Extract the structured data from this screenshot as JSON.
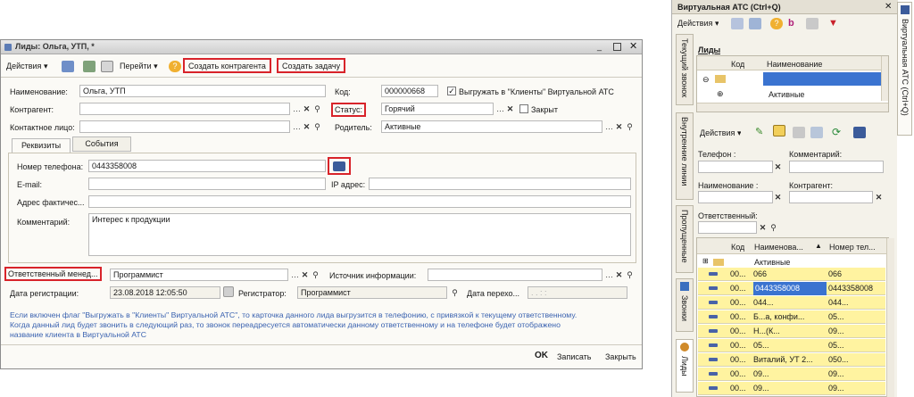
{
  "lead_window": {
    "title": "Лиды: Ольга, УТП, *",
    "toolbar": {
      "actions": "Действия",
      "goto": "Перейти",
      "create_contractor": "Создать контрагента",
      "create_task": "Создать задачу"
    },
    "fields": {
      "name_label": "Наименование:",
      "name_value": "Ольга, УТП",
      "code_label": "Код:",
      "code_value": "000000668",
      "export_checkbox_label": "Выгружать в \"Клиенты\" Виртуальной АТС",
      "export_checked": true,
      "contractor_label": "Контрагент:",
      "contractor_value": "",
      "status_label": "Статус:",
      "status_value": "Горячий",
      "closed_label": "Закрыт",
      "contact_label": "Контактное лицо:",
      "contact_value": "",
      "parent_label": "Родитель:",
      "parent_value": "Активные"
    },
    "tabs": [
      "Реквизиты",
      "События"
    ],
    "details": {
      "phone_label": "Номер телефона:",
      "phone_value": "0443358008",
      "email_label": "E-mail:",
      "email_value": "",
      "ip_label": "IP адрес:",
      "ip_value": "",
      "address_label": "Адрес фактичес...",
      "address_value": "",
      "comment_label": "Комментарий:",
      "comment_value": "Интерес к продукции"
    },
    "bottom": {
      "responsible_label": "Ответственный менед...",
      "responsible_value": "Программист",
      "source_label": "Источник информации:",
      "source_value": "",
      "reg_date_label": "Дата регистрации:",
      "reg_date_value": "23.08.2018 12:05:50",
      "registrar_label": "Регистратор:",
      "registrar_value": "Программист",
      "transfer_date_label": "Дата перехо...",
      "transfer_date_value": ". .     :  :"
    },
    "info_text_1": "Если включен флаг \"Выгружать в \"Клиенты\" Виртуальной АТС\", то карточка данного лида выгрузится в телефонию, с привязкой к текущему ответственному.",
    "info_text_2": "Когда данный лид будет звонить в следующий раз, то звонок переадресуется автоматически данному ответственному и на телефоне будет отображено",
    "info_text_3": "название клиента в Виртуальной АТС",
    "footer": {
      "ok": "OK",
      "save": "Записать",
      "close": "Закрыть"
    }
  },
  "vats_panel": {
    "title": "Виртуальная АТС (Ctrl+Q)",
    "actions": "Действия",
    "side_tabs": [
      "Текущий звонок",
      "Внутренние линии",
      "Пропущенные",
      "Звонки",
      "Лиды"
    ],
    "right_tab": "Виртуальная АТС (Ctrl+Q)",
    "leads_header": "Лиды",
    "tree_columns": [
      "Код",
      "Наименование"
    ],
    "tree_rows": [
      "",
      "Активные"
    ],
    "filter_actions": "Действия",
    "filters": {
      "phone_label": "Телефон :",
      "comment_label": "Комментарий:",
      "name_label": "Наименование :",
      "contractor_label": "Контрагент:",
      "responsible_label": "Ответственный:"
    },
    "list_columns": [
      "Код",
      "Наименова...",
      "Номер тел..."
    ],
    "group_row": "Активные",
    "list_rows": [
      {
        "code": "00...",
        "name": "066",
        "phone": "066"
      },
      {
        "code": "00...",
        "name": "0443358008",
        "phone": "0443358008"
      },
      {
        "code": "00...",
        "name": "044...",
        "phone": "044..."
      },
      {
        "code": "00...",
        "name": "Б...а, конфи...",
        "phone": "05..."
      },
      {
        "code": "00...",
        "name": "Н...(К...",
        "phone": "09..."
      },
      {
        "code": "00...",
        "name": "05...",
        "phone": "05..."
      },
      {
        "code": "00...",
        "name": "Виталий, УТ 2...",
        "phone": "050..."
      },
      {
        "code": "00...",
        "name": "09...",
        "phone": "09..."
      },
      {
        "code": "00...",
        "name": "09...",
        "phone": "09..."
      }
    ]
  },
  "colors": {
    "highlight": "#d8232a",
    "yellow_row": "#fff3a0",
    "selected": "#3a73d0"
  }
}
